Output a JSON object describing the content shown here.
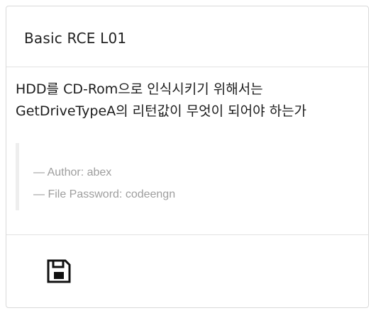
{
  "card": {
    "title": "Basic RCE L01",
    "question_lines": [
      "HDD를 CD-Rom으로 인식시키기 위해서는",
      "GetDriveTypeA의 리턴값이 무엇이 되어야 하는가"
    ],
    "author": "— Author: abex",
    "password": "— File Password: codeengn"
  },
  "footer": {
    "download_icon": "floppy-disk-save-icon"
  }
}
